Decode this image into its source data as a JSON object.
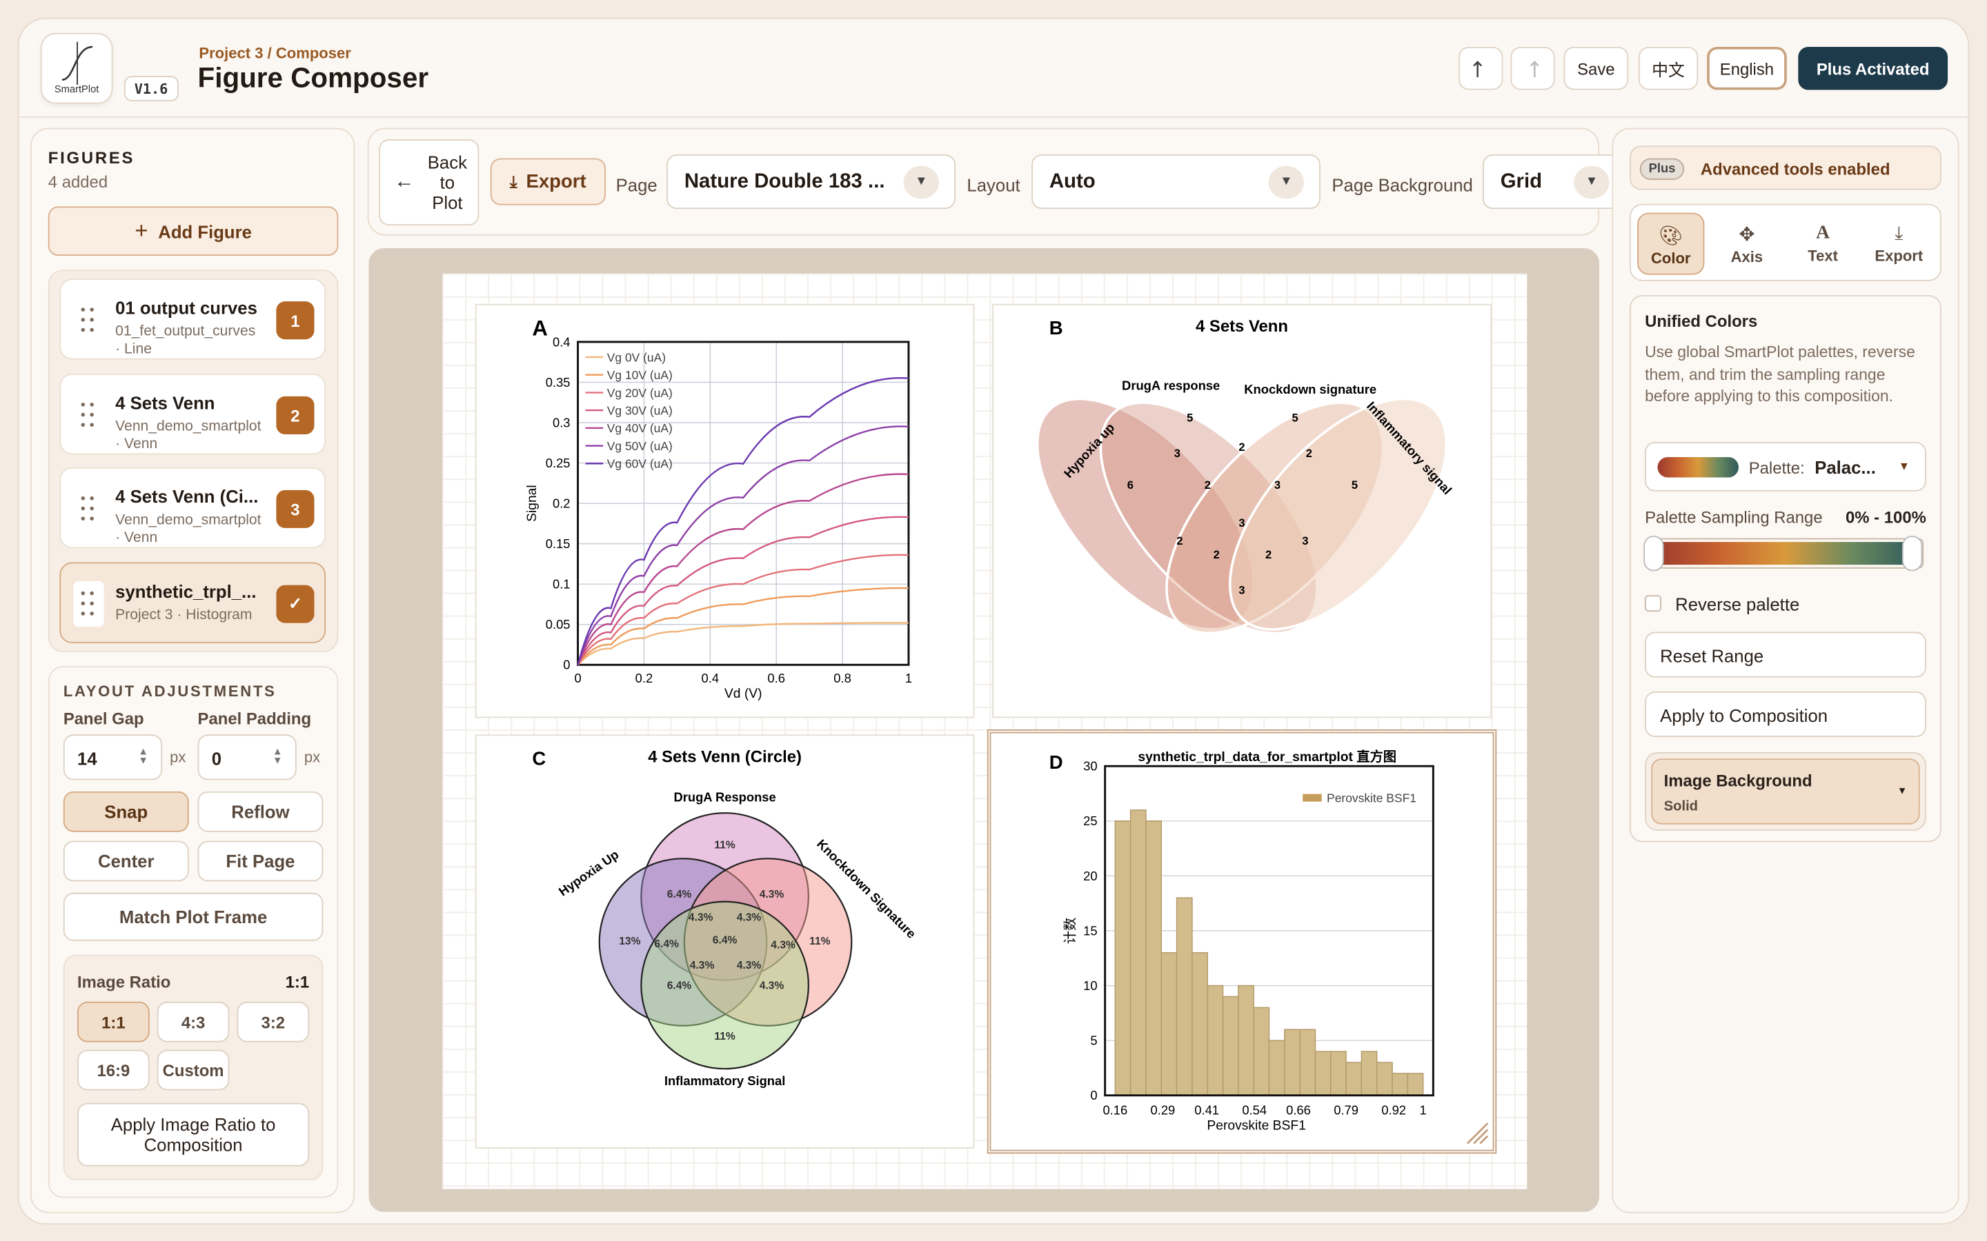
{
  "app": {
    "logo_text": "SmartPlot",
    "version": "V1.6",
    "breadcrumb": "Project 3 / Composer",
    "title": "Figure Composer"
  },
  "header": {
    "undo_icon": "undo-icon",
    "redo_icon": "redo-icon",
    "save": "Save",
    "lang_zh": "中文",
    "lang_en": "English",
    "plus": "Plus Activated"
  },
  "sidebar": {
    "title": "FIGURES",
    "count": "4 added",
    "add": "Add Figure",
    "figures": [
      {
        "name": "01 output curves",
        "sub": "01_fet_output_curves",
        "type": "· Line",
        "badge": "1"
      },
      {
        "name": "4 Sets Venn",
        "sub": "Venn_demo_smartplot",
        "type": "· Venn",
        "badge": "2"
      },
      {
        "name": "4 Sets Venn (Ci...",
        "sub": "Venn_demo_smartplot",
        "type": "· Venn",
        "badge": "3"
      },
      {
        "name": "synthetic_trpl_...",
        "sub": "Project 3 · Histogram",
        "type": "",
        "badge": "✓"
      }
    ],
    "layout": {
      "title": "LAYOUT ADJUSTMENTS",
      "gap_label": "Panel Gap",
      "gap": "14",
      "padding_label": "Panel Padding",
      "padding": "0",
      "unit": "px",
      "snap": "Snap",
      "reflow": "Reflow",
      "center": "Center",
      "fit": "Fit Page",
      "match": "Match Plot Frame"
    },
    "ratio": {
      "title": "Image Ratio",
      "value": "1:1",
      "options": [
        "1:1",
        "4:3",
        "3:2",
        "16:9",
        "Custom"
      ],
      "apply": "Apply Image Ratio to Composition"
    }
  },
  "toolbar": {
    "back": "Back to Plot",
    "export": "Export",
    "page_label": "Page",
    "page_value": "Nature Double 183 ...",
    "layout_label": "Layout",
    "layout_value": "Auto",
    "bg_label": "Page Background",
    "bg_value": "Grid"
  },
  "right": {
    "plus_badge": "Plus",
    "plus_text": "Advanced tools enabled",
    "tabs": [
      "Color",
      "Axis",
      "Text",
      "Export"
    ],
    "colors_title": "Unified Colors",
    "colors_desc": "Use global SmartPlot palettes, reverse them, and trim the sampling range before applying to this composition.",
    "palette_label": "Palette:",
    "palette_value": "Palac...",
    "range_label": "Palette Sampling Range",
    "range_value": "0% - 100%",
    "range": [
      0,
      1
    ],
    "palette_colors": [
      "#9b3a2f",
      "#c8632f",
      "#d89a3c",
      "#6b8a5e",
      "#2f5a5c"
    ],
    "reverse": "Reverse palette",
    "reset": "Reset Range",
    "apply": "Apply to Composition",
    "img_bg_label": "Image Background",
    "img_bg_value": "Solid"
  },
  "chart_data": [
    {
      "type": "line",
      "panel": "A",
      "title": "",
      "xlabel": "Vd (V)",
      "ylabel": "Signal",
      "xlim": [
        0,
        1
      ],
      "ylim": [
        0,
        0.4
      ],
      "xticks": [
        "0",
        "0.2",
        "0.4",
        "0.6",
        "0.8",
        "1"
      ],
      "yticks": [
        "0",
        "0.05",
        "0.1",
        "0.15",
        "0.2",
        "0.25",
        "0.3",
        "0.35",
        "0.4"
      ],
      "series": [
        {
          "name": "Vg 0V (uA)",
          "color": "#f2b57a",
          "x": [
            0,
            0.1,
            0.2,
            0.3,
            0.5,
            0.7,
            1
          ],
          "y": [
            0,
            0.02,
            0.033,
            0.041,
            0.048,
            0.051,
            0.052
          ]
        },
        {
          "name": "Vg 10V (uA)",
          "color": "#ef9a58",
          "x": [
            0,
            0.1,
            0.2,
            0.3,
            0.5,
            0.7,
            1
          ],
          "y": [
            0,
            0.025,
            0.045,
            0.058,
            0.075,
            0.085,
            0.095
          ]
        },
        {
          "name": "Vg 20V (uA)",
          "color": "#e3707a",
          "x": [
            0,
            0.1,
            0.2,
            0.3,
            0.5,
            0.7,
            1
          ],
          "y": [
            0,
            0.032,
            0.058,
            0.076,
            0.1,
            0.118,
            0.136
          ]
        },
        {
          "name": "Vg 30V (uA)",
          "color": "#d4587f",
          "x": [
            0,
            0.1,
            0.2,
            0.3,
            0.5,
            0.7,
            1
          ],
          "y": [
            0,
            0.04,
            0.073,
            0.098,
            0.132,
            0.158,
            0.183
          ]
        },
        {
          "name": "Vg 40V (uA)",
          "color": "#b8488f",
          "x": [
            0,
            0.1,
            0.2,
            0.3,
            0.5,
            0.7,
            1
          ],
          "y": [
            0,
            0.05,
            0.09,
            0.122,
            0.168,
            0.203,
            0.236
          ]
        },
        {
          "name": "Vg 50V (uA)",
          "color": "#8d3fa6",
          "x": [
            0,
            0.1,
            0.2,
            0.3,
            0.5,
            0.7,
            1
          ],
          "y": [
            0,
            0.06,
            0.11,
            0.148,
            0.207,
            0.253,
            0.295
          ]
        },
        {
          "name": "Vg 60V (uA)",
          "color": "#6b37b0",
          "x": [
            0,
            0.1,
            0.2,
            0.3,
            0.5,
            0.7,
            1
          ],
          "y": [
            0,
            0.07,
            0.13,
            0.176,
            0.249,
            0.307,
            0.355
          ]
        }
      ]
    },
    {
      "type": "venn",
      "panel": "B",
      "title": "4 Sets Venn",
      "sets": [
        "Hypoxia up",
        "DrugA response",
        "Knockdown signature",
        "Inflammatory signal"
      ],
      "values": [
        "6",
        "5",
        "5",
        "5",
        "3",
        "2",
        "2",
        "2",
        "3",
        "3",
        "2",
        "2",
        "2",
        "3"
      ]
    },
    {
      "type": "venn",
      "panel": "C",
      "title": "4 Sets Venn (Circle)",
      "sets": [
        "DrugA Response",
        "Hypoxia Up",
        "Knockdown Signature",
        "Inflammatory Signal"
      ],
      "values": [
        "11%",
        "13%",
        "11%",
        "11%",
        "6.4%",
        "4.3%",
        "6.4%",
        "4.3%",
        "4.3%",
        "6.4%",
        "4.3%",
        "4.3%",
        "4.3%",
        "6.4%",
        "4.3%"
      ]
    },
    {
      "type": "bar",
      "panel": "D",
      "title": "synthetic_trpl_data_for_smartplot 直方图",
      "xlabel": "Perovskite BSF1",
      "ylabel": "计数",
      "legend": "Perovskite BSF1",
      "ylim": [
        0,
        30
      ],
      "xticks": [
        "0.16",
        "0.29",
        "0.41",
        "0.54",
        "0.66",
        "0.79",
        "0.92",
        "1"
      ],
      "yticks": [
        "0",
        "5",
        "10",
        "15",
        "20",
        "25",
        "30"
      ],
      "bins_start": 0.16,
      "bins_end": 1.0,
      "values": [
        25,
        26,
        25,
        13,
        18,
        13,
        10,
        9,
        10,
        8,
        5,
        6,
        6,
        4,
        4,
        3,
        4,
        3,
        2,
        2
      ]
    }
  ]
}
